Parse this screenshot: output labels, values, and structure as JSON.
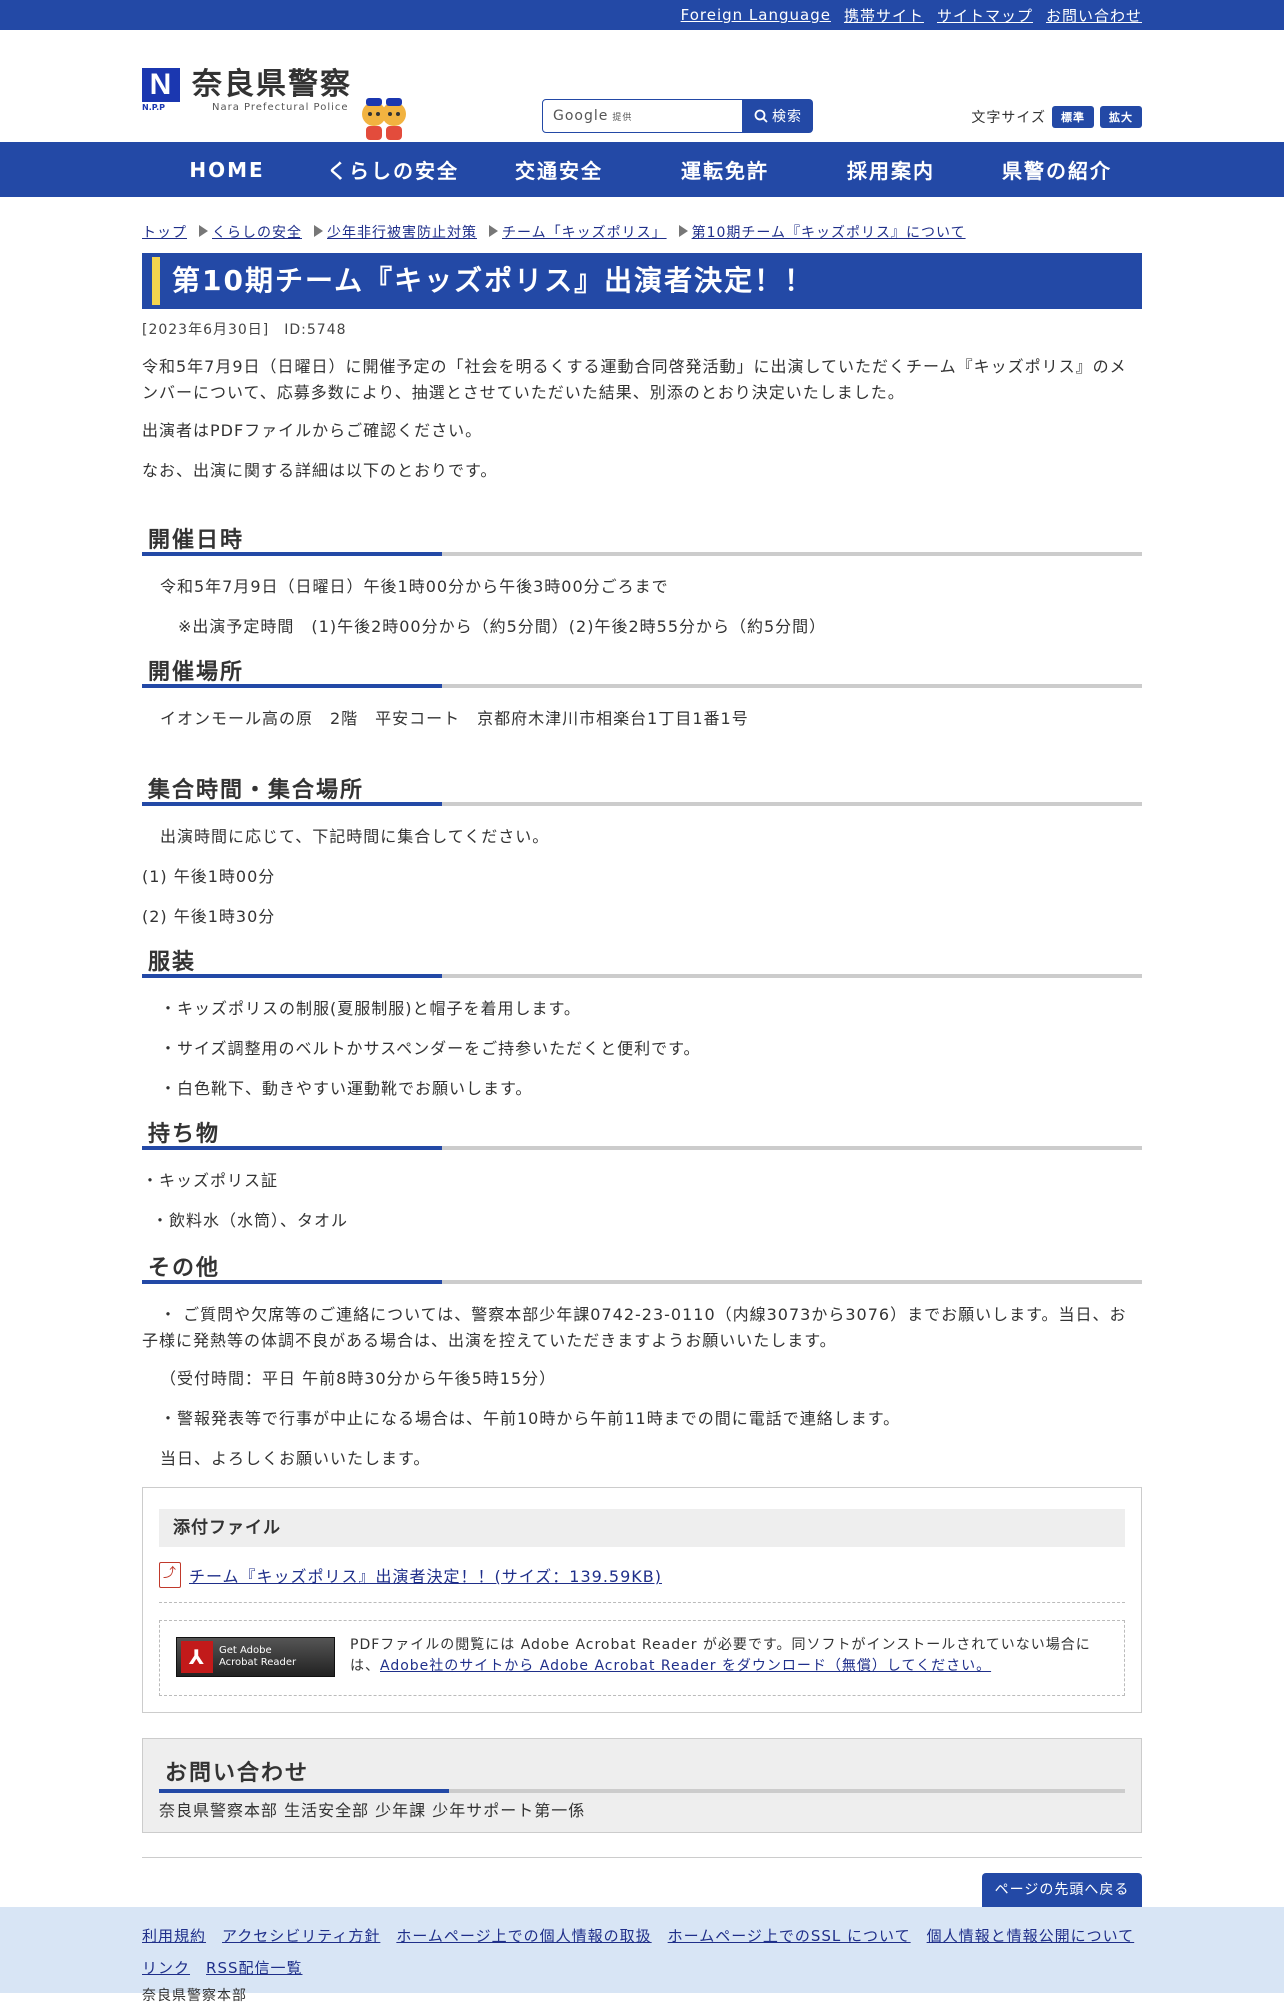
{
  "topbar": {
    "links": [
      "Foreign Language",
      "携帯サイト",
      "サイトマップ",
      "お問い合わせ"
    ]
  },
  "header": {
    "logo_mark": "N",
    "logo_mark_sub": "N.P.P",
    "logo_title": "奈良県警察",
    "logo_subtitle": "Nara Prefectural Police",
    "search": {
      "brand": "Google",
      "brand_small": "提供",
      "button": "検索"
    },
    "fontsize": {
      "label": "文字サイズ",
      "normal": "標準",
      "large": "拡大"
    }
  },
  "nav": [
    "HOME",
    "くらしの安全",
    "交通安全",
    "運転免許",
    "採用案内",
    "県警の紹介"
  ],
  "breadcrumb": [
    "トップ",
    "くらしの安全",
    "少年非行被害防止対策",
    "チーム「キッズポリス」",
    "第10期チーム『キッズポリス』について"
  ],
  "article": {
    "title": "第10期チーム『キッズポリス』出演者決定！！",
    "meta": "[2023年6月30日]　ID:5748",
    "intro1": "令和5年7月9日（日曜日）に開催予定の「社会を明るくする運動合同啓発活動」に出演していただくチーム『キッズポリス』のメンバーについて、応募多数により、抽選とさせていただいた結果、別添のとおり決定いたしました。",
    "intro2": "出演者はPDFファイルからご確認ください。",
    "intro3": "なお、出演に関する詳細は以下のとおりです。",
    "sec1_title": "開催日時",
    "sec1_p1": "令和5年7月9日（日曜日）午後1時00分から午後3時00分ごろまで",
    "sec1_p2": "※出演予定時間　(1)午後2時00分から（約5分間）(2)午後2時55分から（約5分間）",
    "sec2_title": "開催場所",
    "sec2_p1": "イオンモール高の原　2階　平安コート　京都府木津川市相楽台1丁目1番1号",
    "sec3_title": "集合時間・集合場所",
    "sec3_p1": "出演時間に応じて、下記時間に集合してください。",
    "sec3_p2": "(1)  午後1時00分",
    "sec3_p3": "(2)  午後1時30分",
    "sec4_title": "服装",
    "sec4_p1": "・キッズポリスの制服(夏服制服)と帽子を着用します。",
    "sec4_p2": "・サイズ調整用のベルトかサスペンダーをご持参いただくと便利です。",
    "sec4_p3": "・白色靴下、動きやすい運動靴でお願いします。",
    "sec5_title": "持ち物",
    "sec5_p1": "・キッズポリス証",
    "sec5_p2": "・飲料水（水筒）、タオル",
    "sec6_title": "その他",
    "sec6_p1": "・ ご質問や欠席等のご連絡については、警察本部少年課0742-23-0110（内線3073から3076）までお願いします。当日、お子様に発熱等の体調不良がある場合は、出演を控えていただきますようお願いいたします。",
    "sec6_p2": "（受付時間：平日 午前8時30分から午後5時15分）",
    "sec6_p3": "・警報発表等で行事が中止になる場合は、午前10時から午前11時までの間に電話で連絡します。",
    "sec6_p4": "当日、よろしくお願いいたします。"
  },
  "attachments": {
    "heading": "添付ファイル",
    "file_link": "チーム『キッズポリス』出演者決定！！(サイズ：139.59KB)",
    "adobe_button_line1": "Get Adobe",
    "adobe_button_line2": "Acrobat Reader",
    "adobe_text": "PDFファイルの閲覧には Adobe Acrobat Reader が必要です。同ソフトがインストールされていない場合には、",
    "adobe_link": "Adobe社のサイトから Adobe Acrobat Reader をダウンロード（無償）してください。"
  },
  "contact": {
    "heading": "お問い合わせ",
    "text": "奈良県警察本部 生活安全部 少年課 少年サポート第一係"
  },
  "back_to_top": "ページの先頭へ戻る",
  "footer": {
    "links": [
      "利用規約",
      "アクセシビリティ方針",
      "ホームページ上での個人情報の取扱",
      "ホームページ上でのSSL について",
      "個人情報と情報公開について",
      "リンク",
      "RSS配信一覧"
    ],
    "org": "奈良県警察本部"
  }
}
